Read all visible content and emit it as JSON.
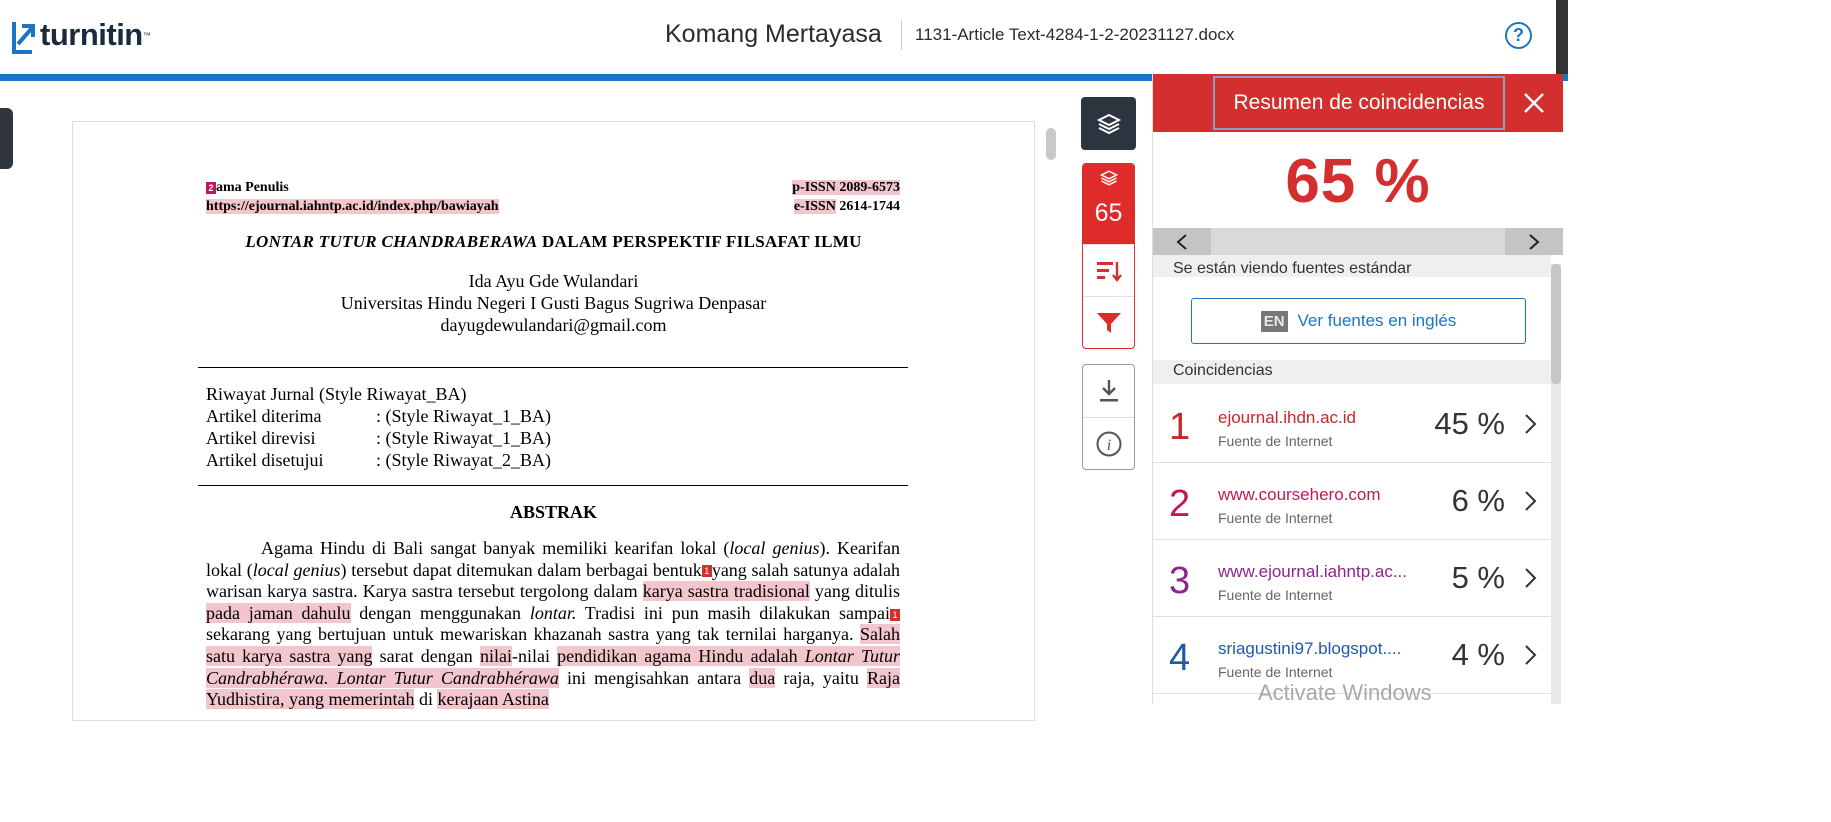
{
  "header": {
    "logo_text": "turnitin",
    "author": "Komang Mertayasa",
    "document_name": "1131-Article Text-4284-1-2-20231127.docx",
    "help_label": "?"
  },
  "document": {
    "marker_2": "2",
    "header_left_1": "ama Penulis",
    "header_left_2": "https://ejournal.iahntp.ac.id/index.php/bawiayah",
    "header_right_1": "p-ISSN 2089-6573",
    "header_right_2a": "e-ISSN",
    "header_right_2b": " 2614-1744",
    "title_italic": "LONTAR TUTUR CHANDRABERAWA",
    "title_rest": " DALAM PERSPEKTIF FILSAFAT ILMU",
    "author_name": "Ida Ayu Gde Wulandari",
    "affiliation": "Universitas Hindu Negeri I Gusti Bagus Sugriwa Denpasar",
    "email": "dayugdewulandari@gmail.com",
    "riwayat_title": "Riwayat Jurnal (Style Riwayat_BA)",
    "riwayat_rows": [
      {
        "label": "Artikel diterima",
        "value": ": (Style Riwayat_1_BA)"
      },
      {
        "label": "Artikel direvisi",
        "value": ": (Style Riwayat_1_BA)"
      },
      {
        "label": "Artikel disetujui",
        "value": ": (Style Riwayat_2_BA)"
      }
    ],
    "abstrak_title": "ABSTRAK",
    "abstrak": {
      "p1": "Agama Hindu di Bali sangat banyak memiliki kearifan lokal (",
      "p1_it": "local genius",
      "p2": "). Kearifan lokal (",
      "p2_it": "local genius",
      "p3": ") tersebut dapat ditemukan dalam berbagai bentuk",
      "marker_1": "1",
      "p4": "yang salah satunya adalah warisan karya sastra. Karya sastra tersebut tergolong dalam ",
      "h1": "karya sastra tradisional",
      "p5": " yang ditulis ",
      "h2": "pada jaman dahulu",
      "p6": " dengan menggunakan ",
      "p6_it": "lontar.",
      "p7": " Tradisi ini pun masih dilakukan sampai",
      "p8": "sekarang yang bertujuan untuk mewariskan khazanah sastra yang tak ternilai harganya. ",
      "h3": "Salah satu karya sastra yang",
      "p9": " sarat dengan ",
      "h4": "nilai",
      "p10": "-nilai ",
      "h5": "pendidikan agama Hindu adalah ",
      "h5_it": "Lontar Tutur Candrabhérawa. Lontar Tutur Candrabhérawa",
      "p11": " ini mengisahkan antara ",
      "h6": "dua",
      "p12": " raja, yaitu ",
      "h7": "Raja Yudhistira, yang memerintah",
      "p13": " di ",
      "h8": "kerajaan Astina"
    }
  },
  "toolbar": {
    "score": "65"
  },
  "panel": {
    "title": "Resumen de coincidencias",
    "overall_percent": "65 %",
    "viewing_text": "Se están viendo fuentes estándar",
    "en_badge": "EN",
    "en_button": "Ver fuentes en inglés",
    "matches_header": "Coincidencias",
    "matches": [
      {
        "n": "1",
        "source": "ejournal.ihdn.ac.id",
        "type": "Fuente de Internet",
        "percent": "45 %",
        "color": "#c62828"
      },
      {
        "n": "2",
        "source": "www.coursehero.com",
        "type": "Fuente de Internet",
        "percent": "6 %",
        "color": "#c2185b"
      },
      {
        "n": "3",
        "source": "www.ejournal.iahntp.ac...",
        "type": "Fuente de Internet",
        "percent": "5 %",
        "color": "#8e2490"
      },
      {
        "n": "4",
        "source": "sriagustini97.blogspot....",
        "type": "Fuente de Internet",
        "percent": "4 %",
        "color": "#1e5aa8"
      }
    ]
  },
  "watermark": "Activate Windows",
  "colors": {
    "brand_blue": "#1b74c4",
    "match_red": "#d32f2f",
    "highlight": "#f2c6cc"
  }
}
